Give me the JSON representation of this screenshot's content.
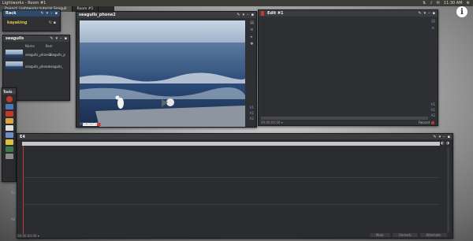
{
  "window": {
    "title": "Lightworks - Room #1",
    "clock": "11:30 AM",
    "tray": [
      "⇅",
      "♪",
      "✉"
    ]
  },
  "tabs": [
    {
      "label": "Project: Lightworks tutorial Seagull",
      "active": true
    },
    {
      "label": "Room #1",
      "active": false
    }
  ],
  "rack": {
    "title": "Rack",
    "item": "kayaking"
  },
  "bin": {
    "title": "seagulls",
    "columns": [
      "Name",
      "Reel"
    ],
    "rows": [
      {
        "name": "seagulls_phone2",
        "reel": "seagulls_p"
      },
      {
        "name": "seagulls_phone",
        "reel": "seagulls_"
      }
    ]
  },
  "tools": {
    "title": "Tools",
    "buttons": [
      "record",
      "import",
      "grid",
      "folder",
      "keyboard",
      "sync",
      "effects",
      "export",
      "search"
    ]
  },
  "viewer": {
    "title": "seagulls_phone2",
    "timecode": "00:00:00:15",
    "track_labels": [
      "V1",
      "A1",
      "A2"
    ]
  },
  "edit": {
    "title": "Edit #1",
    "timecode": "00:00:00:00",
    "record_label": "Record",
    "track_labels": [
      "V1",
      "A1",
      "A2"
    ]
  },
  "timeline": {
    "title": "Edit #1",
    "track_labels": [
      "V1",
      "A1",
      "A2"
    ],
    "timecode": "00:00:00:00",
    "buttons": [
      "Mark",
      "Unmark",
      "Alternate"
    ]
  },
  "colors": {
    "accent": "#c0392b",
    "text_blue": "#7d9fd6"
  }
}
